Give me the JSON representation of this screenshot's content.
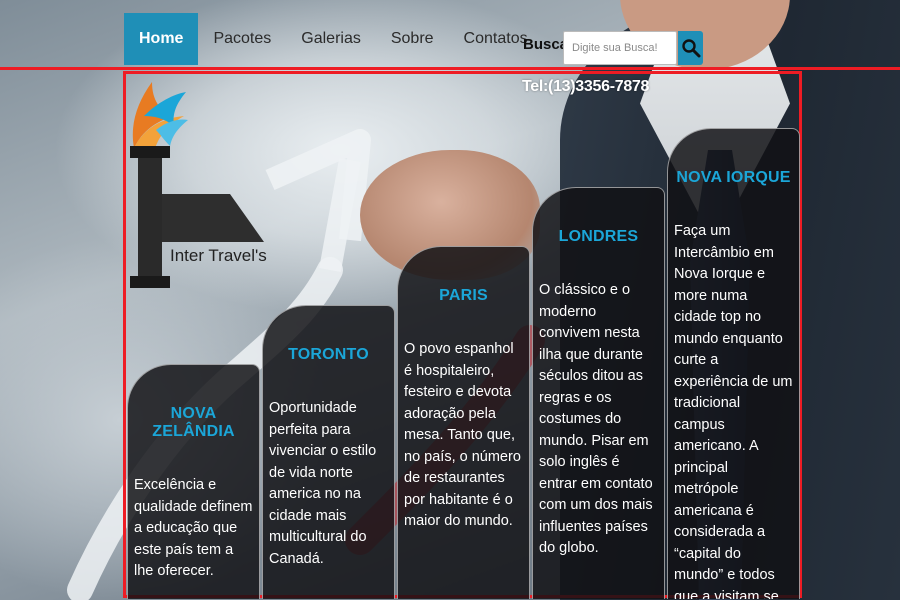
{
  "nav": {
    "items": [
      {
        "label": "Home",
        "active": true
      },
      {
        "label": "Pacotes",
        "active": false
      },
      {
        "label": "Galerias",
        "active": false
      },
      {
        "label": "Sobre",
        "active": false
      },
      {
        "label": "Contatos",
        "active": false
      }
    ],
    "accent_color": "#1f8fb7"
  },
  "search": {
    "label": "Busca:",
    "placeholder": "Digite sua Busca!",
    "button_icon": "search-icon"
  },
  "contact": {
    "phone": "Tel:(13)3356-7878"
  },
  "brand": {
    "name": "Inter Travel's",
    "logo_icon": "plane-swoosh-logo"
  },
  "outline_color": "#ee1c24",
  "cards": [
    {
      "title": "NOVA ZELÂNDIA",
      "text": "Excelência e qualidade definem a educação que este país tem a lhe oferecer."
    },
    {
      "title": "TORONTO",
      "text": "Oportunidade perfeita para vivenciar o estilo de vida norte america no na cidade mais multicultural do Canadá."
    },
    {
      "title": "PARIS",
      "text": "O povo espanhol é hospitaleiro, festeiro e devota adoração pela mesa. Tanto que, no país, o número de restaurantes por habitante é o maior do mundo."
    },
    {
      "title": "LONDRES",
      "text": "O clássico e o moderno convivem nesta ilha que durante séculos ditou as regras e os costumes do mundo. Pisar em solo inglês é entrar em contato com um dos mais influentes países do globo."
    },
    {
      "title": "NOVA IORQUE",
      "text": "Faça um Intercâmbio em Nova Iorque e more numa cidade top no mundo enquanto curte a experiência de um tradicional campus americano. A principal metrópole americana é considerada a “capital do mundo” e todos que a visitam se sentem em casa."
    }
  ],
  "card_title_color": "#1ba6d8"
}
